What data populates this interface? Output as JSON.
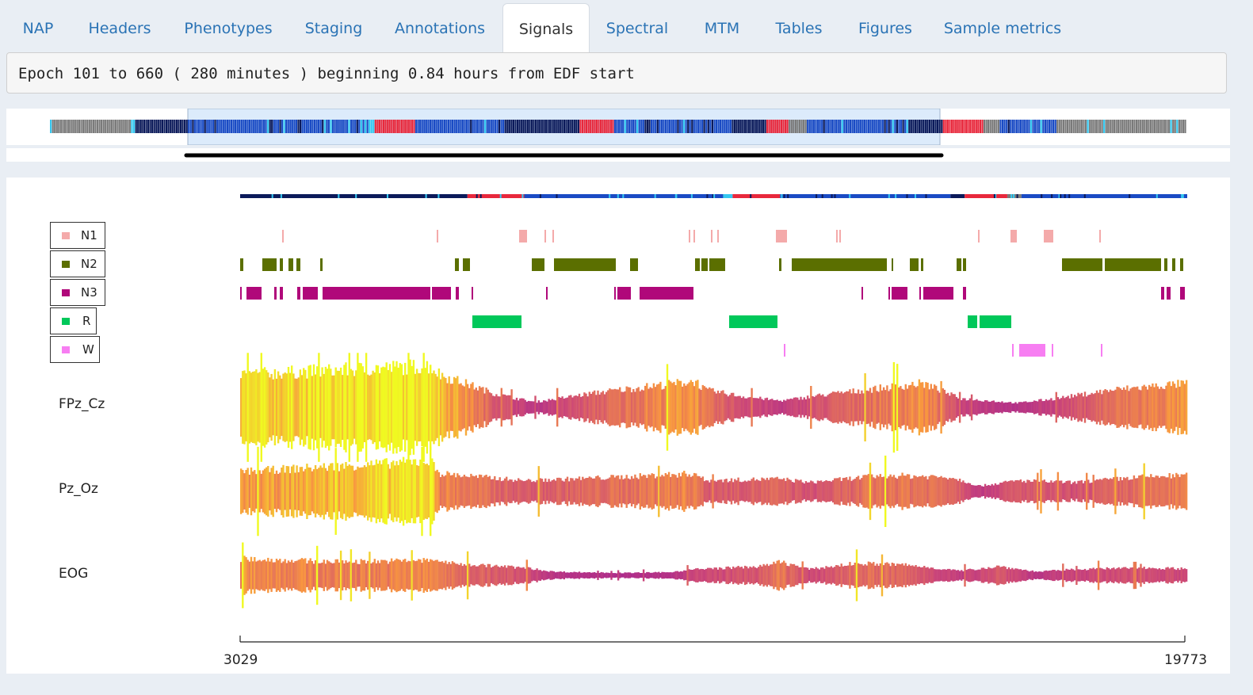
{
  "tabs": [
    {
      "label": "NAP"
    },
    {
      "label": "Headers"
    },
    {
      "label": "Phenotypes"
    },
    {
      "label": "Staging"
    },
    {
      "label": "Annotations"
    },
    {
      "label": "Signals"
    },
    {
      "label": "Spectral"
    },
    {
      "label": "MTM"
    },
    {
      "label": "Tables"
    },
    {
      "label": "Figures"
    },
    {
      "label": "Sample metrics"
    }
  ],
  "active_tab": "Signals",
  "info": {
    "text": "Epoch 101 to 660 ( 280 minutes ) beginning 0.84 hours from EDF start"
  },
  "stage_legend": [
    {
      "label": "N1",
      "color": "#f4aaaa"
    },
    {
      "label": "N2",
      "color": "#5b6f00"
    },
    {
      "label": "N3",
      "color": "#b0087a"
    },
    {
      "label": "R",
      "color": "#00c85a"
    },
    {
      "label": "W",
      "color": "#f77ef2"
    }
  ],
  "channels": [
    {
      "label": "FPz_Cz"
    },
    {
      "label": "Pz_Oz"
    },
    {
      "label": "EOG"
    }
  ],
  "x_axis": {
    "start_label": "3029",
    "end_label": "19773"
  },
  "colors": {
    "tab_link": "#2a73b5",
    "hypno_wake": "#7a7a7a",
    "hypno_n3": "#0b1a5a",
    "hypno_n2": "#1a4bc4",
    "hypno_n1": "#35c8f0",
    "hypno_rem": "#e8283c",
    "selection": "#dcebfb"
  }
}
